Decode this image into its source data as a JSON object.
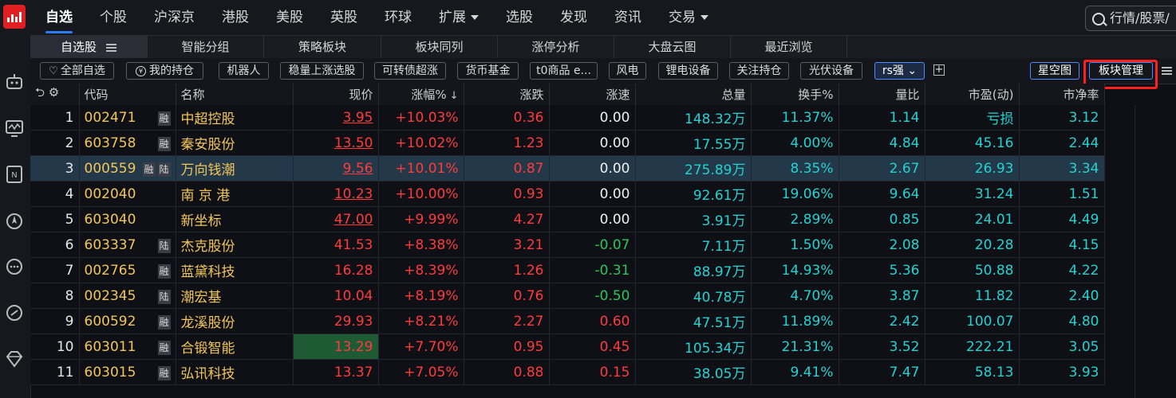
{
  "nav": {
    "items": [
      {
        "label": "自选",
        "active": true
      },
      {
        "label": "个股"
      },
      {
        "label": "沪深京"
      },
      {
        "label": "港股"
      },
      {
        "label": "美股"
      },
      {
        "label": "英股"
      },
      {
        "label": "环球"
      },
      {
        "label": "扩展",
        "dropdown": true
      },
      {
        "label": "选股"
      },
      {
        "label": "发现"
      },
      {
        "label": "资讯"
      },
      {
        "label": "交易",
        "dropdown": true
      }
    ],
    "search_placeholder": "行情/股票/"
  },
  "tabs": [
    "自选股",
    "智能分组",
    "策略板块",
    "板块同列",
    "涨停分析",
    "大盘云图",
    "最近浏览"
  ],
  "chips": {
    "all_watch": "全部自选",
    "my_holdings": "我的持仓",
    "items": [
      "机器人",
      "稳量上涨选股",
      "可转债超涨",
      "货币基金",
      "t0商品 e...",
      "风电",
      "锂电设备",
      "关注持仓",
      "光伏设备"
    ],
    "selected": "rs强",
    "star_map": "星空图",
    "sector_manage": "板块管理"
  },
  "table": {
    "headers": {
      "code": "代码",
      "name": "名称",
      "price": "现价",
      "change_pct": "涨幅%",
      "change": "涨跌",
      "speed": "涨速",
      "volume": "总量",
      "turnover": "换手%",
      "vol_ratio": "量比",
      "pe": "市盈(动)",
      "pb": "市净率"
    },
    "rows": [
      {
        "idx": "1",
        "code": "002471",
        "tags": [
          "融"
        ],
        "name": "中超控股",
        "price": "3.95",
        "pct": "+10.03%",
        "chg": "0.36",
        "speed": "0.00",
        "vol": "148.32万",
        "turn": "11.37%",
        "ratio": "1.14",
        "pe": "亏损",
        "pb": "3.12"
      },
      {
        "idx": "2",
        "code": "603758",
        "tags": [
          "融"
        ],
        "name": "秦安股份",
        "price": "13.50",
        "pct": "+10.02%",
        "chg": "1.23",
        "speed": "0.00",
        "vol": "17.55万",
        "turn": "4.00%",
        "ratio": "4.84",
        "pe": "45.16",
        "pb": "2.44"
      },
      {
        "idx": "3",
        "code": "000559",
        "tags": [
          "融",
          "陆"
        ],
        "name": "万向钱潮",
        "price": "9.56",
        "pct": "+10.01%",
        "chg": "0.87",
        "speed": "0.00",
        "vol": "275.89万",
        "turn": "8.35%",
        "ratio": "2.67",
        "pe": "26.93",
        "pb": "3.34"
      },
      {
        "idx": "4",
        "code": "002040",
        "tags": [],
        "name": "南 京 港",
        "price": "10.23",
        "pct": "+10.00%",
        "chg": "0.93",
        "speed": "0.00",
        "vol": "92.61万",
        "turn": "19.06%",
        "ratio": "9.64",
        "pe": "31.24",
        "pb": "1.51"
      },
      {
        "idx": "5",
        "code": "603040",
        "tags": [],
        "name": "新坐标",
        "price": "47.00",
        "pct": "+9.99%",
        "chg": "4.27",
        "speed": "0.00",
        "vol": "3.91万",
        "turn": "2.89%",
        "ratio": "0.85",
        "pe": "24.01",
        "pb": "4.49"
      },
      {
        "idx": "6",
        "code": "603337",
        "tags": [
          "陆"
        ],
        "name": "杰克股份",
        "price": "41.53",
        "pct": "+8.38%",
        "chg": "3.21",
        "speed": "-0.07",
        "vol": "7.11万",
        "turn": "1.50%",
        "ratio": "2.08",
        "pe": "20.28",
        "pb": "4.15"
      },
      {
        "idx": "7",
        "code": "002765",
        "tags": [
          "融"
        ],
        "name": "蓝黛科技",
        "price": "16.28",
        "pct": "+8.39%",
        "chg": "1.26",
        "speed": "-0.31",
        "vol": "88.97万",
        "turn": "14.93%",
        "ratio": "5.36",
        "pe": "50.88",
        "pb": "4.22"
      },
      {
        "idx": "8",
        "code": "002345",
        "tags": [
          "陆"
        ],
        "name": "潮宏基",
        "price": "10.04",
        "pct": "+8.19%",
        "chg": "0.76",
        "speed": "-0.50",
        "vol": "40.78万",
        "turn": "4.70%",
        "ratio": "3.87",
        "pe": "11.82",
        "pb": "2.40"
      },
      {
        "idx": "9",
        "code": "600592",
        "tags": [
          "融"
        ],
        "name": "龙溪股份",
        "price": "29.93",
        "pct": "+8.21%",
        "chg": "2.27",
        "speed": "0.60",
        "vol": "47.51万",
        "turn": "11.89%",
        "ratio": "2.42",
        "pe": "100.07",
        "pb": "4.80"
      },
      {
        "idx": "10",
        "code": "603011",
        "tags": [
          "融"
        ],
        "name": "合锻智能",
        "price": "13.29",
        "pct": "+7.70%",
        "chg": "0.95",
        "speed": "0.45",
        "vol": "105.34万",
        "turn": "21.31%",
        "ratio": "3.52",
        "pe": "222.21",
        "pb": "3.05"
      },
      {
        "idx": "11",
        "code": "603015",
        "tags": [
          "融"
        ],
        "name": "弘讯科技",
        "price": "13.37",
        "pct": "+7.05%",
        "chg": "0.88",
        "speed": "0.15",
        "vol": "38.05万",
        "turn": "9.41%",
        "ratio": "7.47",
        "pe": "58.13",
        "pb": "3.93"
      }
    ]
  },
  "colors": {
    "up": "#ff3b3b",
    "down": "#2ec45c",
    "code": "#f2c65a",
    "cyan": "#22d3d3",
    "accent": "#2b7cf0",
    "highlight": "#ff1f1f"
  }
}
